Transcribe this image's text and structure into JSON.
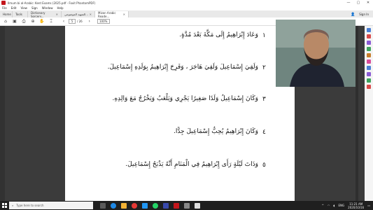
{
  "window": {
    "title": "Ilmum bi al-Arabic: Kent Exams (2025.pdf - Foxit PhantomPDF)",
    "controls": {
      "minimize": "—",
      "maximize": "▢",
      "close": "✕"
    }
  },
  "menu": {
    "items": [
      "File",
      "Edit",
      "View",
      "Sign",
      "Window",
      "Help"
    ]
  },
  "tabs": {
    "home": "Home",
    "tools": "Tools",
    "doc1": "Dictionary Sorcery...",
    "doc2": "التمهيد الموضوعي...",
    "doc3": "Mizan Arabic Reade...",
    "signin": "Sign In"
  },
  "toolbar": {
    "page_current": "5",
    "page_total": "/ 26",
    "zoom": "100%"
  },
  "document": {
    "lines": [
      {
        "num": "١",
        "text": "وَعَادَ إِبْرَاهِيمُ إِلَى مَكَّةَ بَعْدَ مُدَّةٍ."
      },
      {
        "num": "٢",
        "text": "وَلَقِيَ إِسْمَاعِيلَ وَلَقِيَ هَاجَرَ ، وَفَرِحَ إِبْرَاهِيمُ بِوَلَدِهِ إِسْمَاعِيلَ."
      },
      {
        "num": "٣",
        "text": "وَكَانَ إِسْمَاعِيلُ وَلَدًا صَغِيرًا يَجْرِي وَيَلْعَبُ وَيَخْرُجُ مَعَ وَالِدِهِ."
      },
      {
        "num": "٤",
        "text": "وَكَانَ إِبْرَاهِيمُ يُحِبُّ إِسْمَاعِيلَ جِدًّا."
      },
      {
        "num": "٥",
        "text": "وَذَاتَ لَيْلَةٍ رَأَى إِبْرَاهِيمُ فِي الْمَنَامِ أَنَّهُ يَذْبَحُ إِسْمَاعِيلَ."
      }
    ]
  },
  "taskbar": {
    "search_placeholder": "Type here to search",
    "language": "ENG",
    "time": "11:21 AM",
    "date": "2020/10/16"
  },
  "colors": {
    "accent": "#c4161c",
    "dark_pane": "#3b3b3b",
    "taskbar": "#1f1f1f"
  }
}
